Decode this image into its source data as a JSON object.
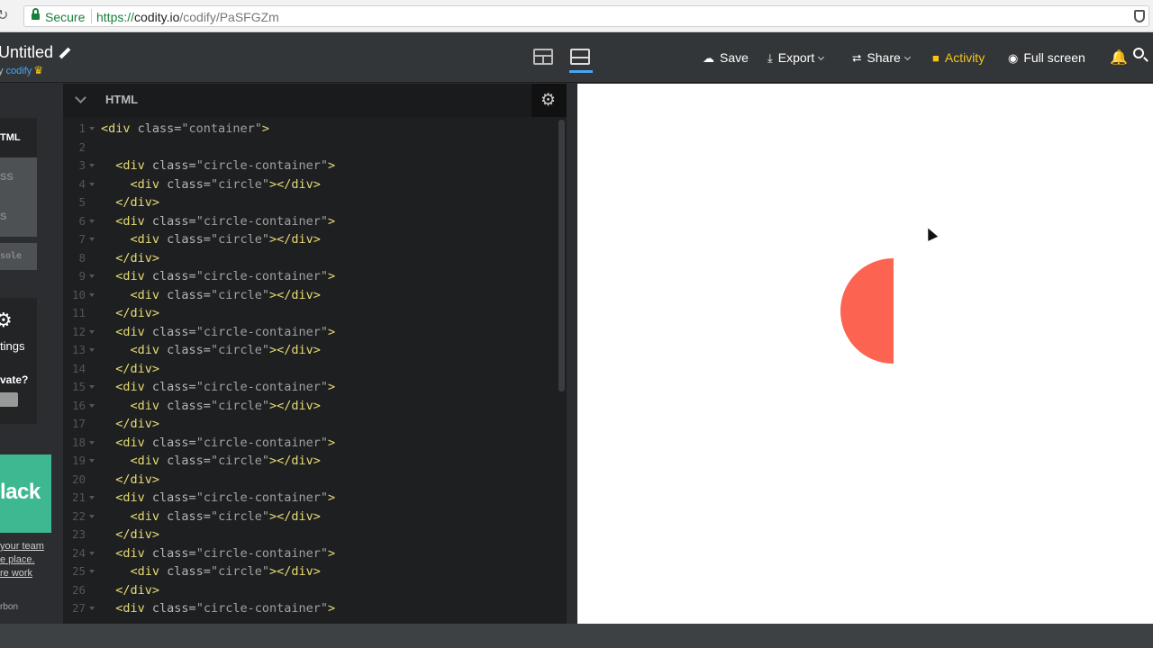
{
  "browser": {
    "secure_label": "Secure",
    "url_scheme": "https://",
    "url_host": "codity.io",
    "url_path": "/codify/PaSFGZm"
  },
  "header": {
    "project_title": "Untitled",
    "by_prefix": "y ",
    "brand": "codify",
    "save": "Save",
    "export": "Export",
    "share": "Share",
    "activity": "Activity",
    "fullscreen": "Full screen"
  },
  "sidebar": {
    "langs": [
      "TML",
      "SS",
      "S"
    ],
    "console": "sole",
    "settings": "tings",
    "private": "vate?",
    "ad_brand": "lack",
    "ad_lines": [
      "your team",
      "e place.",
      "re work"
    ],
    "carbon": "rbon"
  },
  "editor": {
    "title": "HTML",
    "lines": [
      {
        "n": "1",
        "fold": true,
        "indent": "",
        "tag": "<div ",
        "attr": "class=",
        "str": "\"container\"",
        "end": ">"
      },
      {
        "n": "2",
        "fold": false,
        "indent": "",
        "tag": "",
        "attr": "",
        "str": "",
        "end": ""
      },
      {
        "n": "3",
        "fold": true,
        "indent": "  ",
        "tag": "<div ",
        "attr": "class=",
        "str": "\"circle-container\"",
        "end": ">"
      },
      {
        "n": "4",
        "fold": true,
        "indent": "    ",
        "tag": "<div ",
        "attr": "class=",
        "str": "\"circle\"",
        "end": "></div>"
      },
      {
        "n": "5",
        "fold": false,
        "indent": "  ",
        "tag": "</div>",
        "attr": "",
        "str": "",
        "end": ""
      },
      {
        "n": "6",
        "fold": true,
        "indent": "  ",
        "tag": "<div ",
        "attr": "class=",
        "str": "\"circle-container\"",
        "end": ">"
      },
      {
        "n": "7",
        "fold": true,
        "indent": "    ",
        "tag": "<div ",
        "attr": "class=",
        "str": "\"circle\"",
        "end": "></div>"
      },
      {
        "n": "8",
        "fold": false,
        "indent": "  ",
        "tag": "</div>",
        "attr": "",
        "str": "",
        "end": ""
      },
      {
        "n": "9",
        "fold": true,
        "indent": "  ",
        "tag": "<div ",
        "attr": "class=",
        "str": "\"circle-container\"",
        "end": ">"
      },
      {
        "n": "10",
        "fold": true,
        "indent": "    ",
        "tag": "<div ",
        "attr": "class=",
        "str": "\"circle\"",
        "end": "></div>"
      },
      {
        "n": "11",
        "fold": false,
        "indent": "  ",
        "tag": "</div>",
        "attr": "",
        "str": "",
        "end": ""
      },
      {
        "n": "12",
        "fold": true,
        "indent": "  ",
        "tag": "<div ",
        "attr": "class=",
        "str": "\"circle-container\"",
        "end": ">"
      },
      {
        "n": "13",
        "fold": true,
        "indent": "    ",
        "tag": "<div ",
        "attr": "class=",
        "str": "\"circle\"",
        "end": "></div>"
      },
      {
        "n": "14",
        "fold": false,
        "indent": "  ",
        "tag": "</div>",
        "attr": "",
        "str": "",
        "end": ""
      },
      {
        "n": "15",
        "fold": true,
        "indent": "  ",
        "tag": "<div ",
        "attr": "class=",
        "str": "\"circle-container\"",
        "end": ">"
      },
      {
        "n": "16",
        "fold": true,
        "indent": "    ",
        "tag": "<div ",
        "attr": "class=",
        "str": "\"circle\"",
        "end": "></div>"
      },
      {
        "n": "17",
        "fold": false,
        "indent": "  ",
        "tag": "</div>",
        "attr": "",
        "str": "",
        "end": ""
      },
      {
        "n": "18",
        "fold": true,
        "indent": "  ",
        "tag": "<div ",
        "attr": "class=",
        "str": "\"circle-container\"",
        "end": ">"
      },
      {
        "n": "19",
        "fold": true,
        "indent": "    ",
        "tag": "<div ",
        "attr": "class=",
        "str": "\"circle\"",
        "end": "></div>"
      },
      {
        "n": "20",
        "fold": false,
        "indent": "  ",
        "tag": "</div>",
        "attr": "",
        "str": "",
        "end": ""
      },
      {
        "n": "21",
        "fold": true,
        "indent": "  ",
        "tag": "<div ",
        "attr": "class=",
        "str": "\"circle-container\"",
        "end": ">"
      },
      {
        "n": "22",
        "fold": true,
        "indent": "    ",
        "tag": "<div ",
        "attr": "class=",
        "str": "\"circle\"",
        "end": "></div>"
      },
      {
        "n": "23",
        "fold": false,
        "indent": "  ",
        "tag": "</div>",
        "attr": "",
        "str": "",
        "end": ""
      },
      {
        "n": "24",
        "fold": true,
        "indent": "  ",
        "tag": "<div ",
        "attr": "class=",
        "str": "\"circle-container\"",
        "end": ">"
      },
      {
        "n": "25",
        "fold": true,
        "indent": "    ",
        "tag": "<div ",
        "attr": "class=",
        "str": "\"circle\"",
        "end": "></div>"
      },
      {
        "n": "26",
        "fold": false,
        "indent": "  ",
        "tag": "</div>",
        "attr": "",
        "str": "",
        "end": ""
      },
      {
        "n": "27",
        "fold": true,
        "indent": "  ",
        "tag": "<div ",
        "attr": "class=",
        "str": "\"circle-container\"",
        "end": ">"
      }
    ]
  },
  "preview": {
    "shape_color": "#fd6351"
  },
  "colors": {
    "accent": "#4aa3f0",
    "activity": "#f5c518",
    "secure": "#188038"
  }
}
